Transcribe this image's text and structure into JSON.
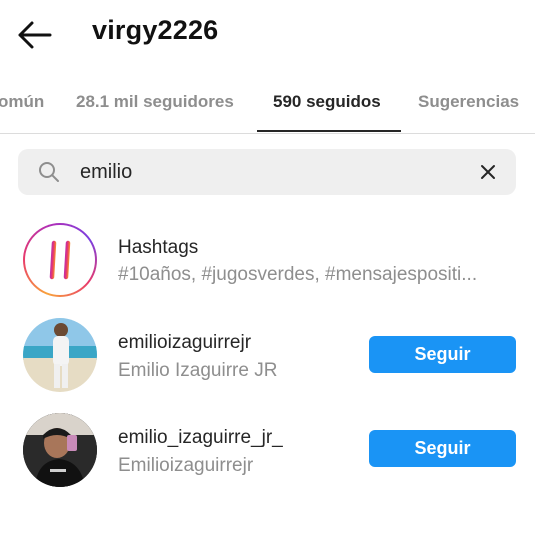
{
  "header": {
    "title": "virgy2226",
    "back_icon": "back-arrow-icon"
  },
  "tabs": [
    {
      "label": "omún"
    },
    {
      "label": "28.1 mil seguidores"
    },
    {
      "label": "590 seguidos",
      "active": true
    },
    {
      "label": "Sugerencias"
    }
  ],
  "search": {
    "value": "emilio",
    "search_icon": "search-icon",
    "clear_icon": "close-icon"
  },
  "results": [
    {
      "type": "hashtag",
      "title": "Hashtags",
      "subtitle": "#10años, #jugosverdes, #mensajespositi..."
    },
    {
      "type": "user",
      "username": "emilioizaguirrejr",
      "full_name": "Emilio Izaguirre JR",
      "action": "Seguir"
    },
    {
      "type": "user",
      "username": "emilio_izaguirre_jr_",
      "full_name": "Emilioizaguirrejr",
      "action": "Seguir"
    }
  ],
  "colors": {
    "accent": "#1a94f5",
    "muted_text": "#8e8e8e",
    "primary_text": "#262626"
  }
}
